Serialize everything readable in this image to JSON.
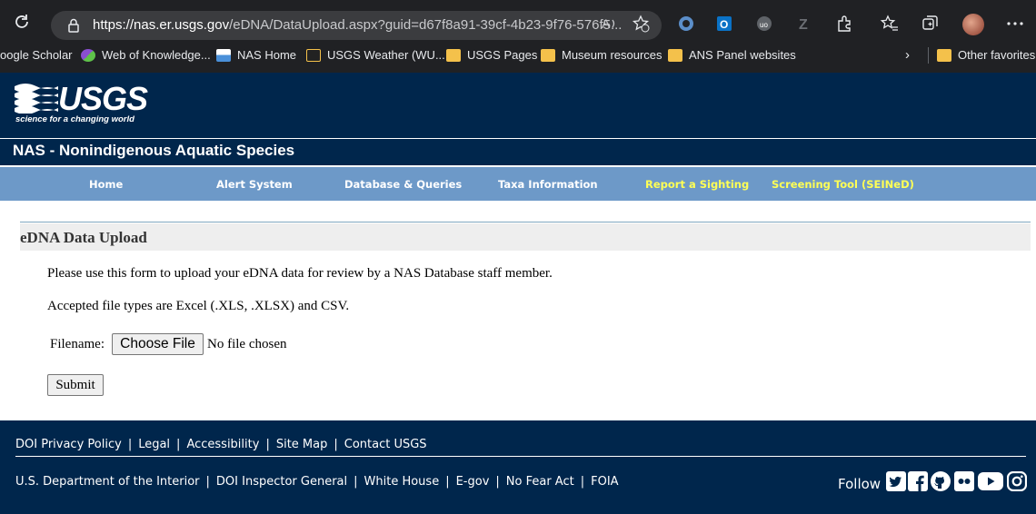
{
  "browser": {
    "url_host": "https://nas.er.usgs.gov",
    "url_rest": "/eDNA/DataUpload.aspx?guid=d67f8a91-39cf-4b23-9f76-576f5...",
    "bookmarks": [
      "oogle Scholar",
      "Web of Knowledge...",
      "NAS Home",
      "USGS Weather (WU...",
      "USGS Pages",
      "Museum resources",
      "ANS Panel websites"
    ],
    "other_favorites": "Other favorites"
  },
  "header": {
    "logo_text": "USGS",
    "logo_tagline": "science for a changing world",
    "site_title": "NAS - Nonindigenous Aquatic Species"
  },
  "nav": {
    "items": [
      "Home",
      "Alert System",
      "Database & Queries",
      "Taxa Information",
      "Report a Sighting",
      "Screening Tool (SEINeD)"
    ]
  },
  "main": {
    "title": "eDNA Data Upload",
    "intro": "Please use this form to upload your eDNA data for review by a NAS Database staff member.",
    "file_types": "Accepted file types are Excel (.XLS, .XLSX) and CSV.",
    "filename_label": "Filename:",
    "choose_file": "Choose File",
    "no_file": "No file chosen",
    "submit": "Submit"
  },
  "footer": {
    "row1": [
      "DOI Privacy Policy",
      "Legal",
      "Accessibility",
      "Site Map",
      "Contact USGS"
    ],
    "row2": [
      "U.S. Department of the Interior",
      "DOI Inspector General",
      "White House",
      "E-gov",
      "No Fear Act",
      "FOIA"
    ],
    "follow": "Follow",
    "social": [
      "twitter-icon",
      "facebook-icon",
      "github-icon",
      "flickr-icon",
      "youtube-icon",
      "instagram-icon"
    ]
  },
  "colors": {
    "usgs_navy": "#00264c",
    "nav_blue": "#6d99c8",
    "nav_highlight": "#ffff55"
  }
}
